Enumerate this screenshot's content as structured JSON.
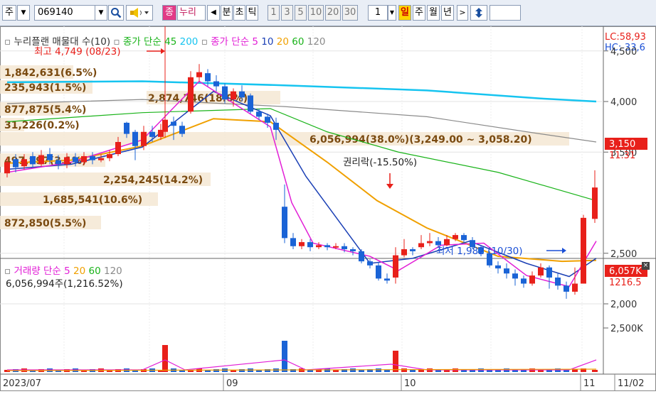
{
  "toolbar": {
    "market_label": "주",
    "stock_code": "069140",
    "category_label": "종",
    "stock_name": "누리",
    "period_items": [
      "분",
      "초",
      "틱",
      "1",
      "3",
      "5",
      "10",
      "20",
      "30"
    ],
    "interval_value": "1",
    "day_label": "일",
    "week_label": "주",
    "month_label": "월",
    "year_label": "년"
  },
  "price_panel": {
    "legend": {
      "main": "누리플랜 매물대 수(10)",
      "ma_group1": "종가 단순 45",
      "ma_group1_extra": "200",
      "ma_group2": "종가 단순 5",
      "ma_group2_vals": [
        "10",
        "20",
        "60",
        "120"
      ]
    },
    "high_annotation": "최고 4,749 (08/23)",
    "low_annotation": "최저 1,982 (10/30)",
    "rights_annotation": "권리락(-15.50%)",
    "lc_label": "LC:58,93",
    "hc_label": "HC:-33,6",
    "current_price": "3,150",
    "current_change": "11.31",
    "y_ticks": [
      "4,500",
      "4,000",
      "3,500",
      "2,500",
      "2,000"
    ],
    "volume_profile": [
      {
        "label": "1,842,631(6.5%)"
      },
      {
        "label": "235,943(1.5%)"
      },
      {
        "label": "877,875(5.4%)"
      },
      {
        "label": "31,226(0.2%)"
      },
      {
        "label": "6,056,994(38.0%)(3,249.00 ~ 3,058.20)"
      },
      {
        "label": "497,897(3.1%)"
      },
      {
        "label": "2,254,245(14.2%)"
      },
      {
        "label": "1,685,541(10.6%)"
      },
      {
        "label": "872,850(5.5%)"
      },
      {
        "label": "2,874,746(18.0%)"
      }
    ]
  },
  "volume_panel": {
    "legend": "거래량 단순 5",
    "legend_vals": [
      "20",
      "60",
      "120"
    ],
    "info": "6,056,994주(1,216.52%)",
    "current_volume": "6,057K",
    "current_pct": "1216.5",
    "y_ticks": [
      "2,500K"
    ]
  },
  "x_axis": {
    "labels": [
      "2023/07",
      "09",
      "10",
      "11",
      "11/02"
    ]
  },
  "colors": {
    "up": "#e8201a",
    "down": "#1a63d6",
    "ma5": "#e21fd6",
    "ma10": "#1a3fb5",
    "ma20": "#f0a000",
    "ma60": "#19b319",
    "ma120": "#8a8a8a",
    "ma45": "#16c4f0",
    "profile": "#f5e7d3",
    "profile_text": "#7a4a10"
  }
}
